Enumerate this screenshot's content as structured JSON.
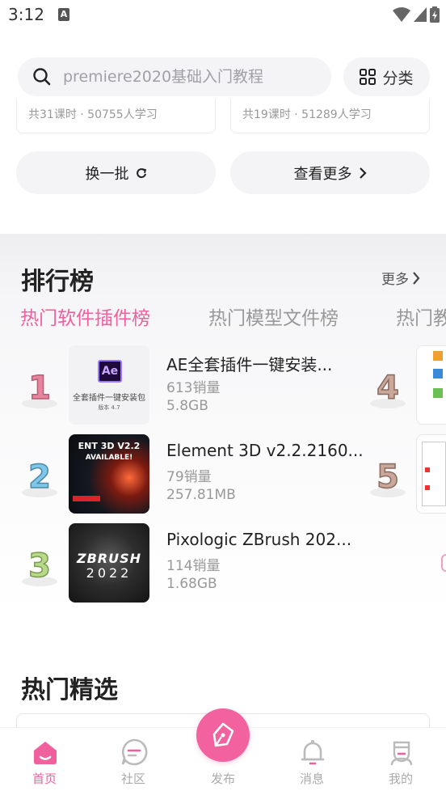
{
  "status_bar": {
    "time": "3:12",
    "notif_icon": "A"
  },
  "search": {
    "placeholder": "premiere2020基础入门教程"
  },
  "category_button": {
    "label": "分类"
  },
  "courses": [
    {
      "meta": "共31课时 · 50755人学习"
    },
    {
      "meta": "共19课时 · 51289人学习"
    }
  ],
  "buttons": {
    "refresh": "换一批",
    "more": "查看更多"
  },
  "ranking": {
    "title": "排行榜",
    "more": "更多",
    "tabs": [
      "热门软件插件榜",
      "热门模型文件榜",
      "热门教"
    ],
    "items": [
      {
        "rank": "1",
        "name": "AE全套插件一键安装...",
        "sales": "613销量",
        "size": "5.8GB",
        "thumb_text": "全套插件一键安装包",
        "thumb_sub": "版本 4.7",
        "thumb_logo": "Ae"
      },
      {
        "rank": "2",
        "name": "Element 3D v2.2.2160...",
        "sales": "79销量",
        "size": "257.81MB",
        "thumb_text": "ENT 3D V2.2",
        "thumb_sub": "AVAILABLE!"
      },
      {
        "rank": "3",
        "name": "Pixologic ZBrush 202...",
        "sales": "114销量",
        "size": "1.68GB",
        "thumb_text": "ZBRUSH",
        "thumb_sub": "2022"
      }
    ],
    "right_ranks": [
      "4",
      "5"
    ]
  },
  "featured": {
    "title": "热门精选"
  },
  "tabbar": {
    "tabs": [
      {
        "label": "首页",
        "icon": "home-icon"
      },
      {
        "label": "社区",
        "icon": "community-icon"
      },
      {
        "label": "发布",
        "icon": "publish-icon"
      },
      {
        "label": "消息",
        "icon": "bell-icon"
      },
      {
        "label": "我的",
        "icon": "profile-icon"
      }
    ]
  },
  "colors": {
    "accent": "#f0609c",
    "muted": "#999999",
    "bg_soft": "#f4f4f6"
  }
}
